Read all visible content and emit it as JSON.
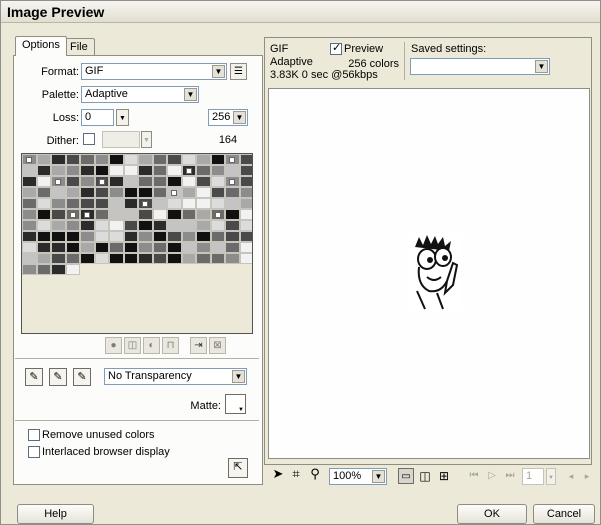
{
  "window": {
    "title": "Image Preview"
  },
  "tabs": [
    {
      "label": "Options",
      "active": true
    },
    {
      "label": "File",
      "active": false
    }
  ],
  "options": {
    "format_label": "Format:",
    "format_value": "GIF",
    "palette_label": "Palette:",
    "palette_value": "Adaptive",
    "loss_label": "Loss:",
    "loss_value": "0",
    "colors_value": "256",
    "dither_label": "Dither:",
    "dither_checked": false,
    "color_count": "164",
    "transparency_value": "No Transparency",
    "matte_label": "Matte:",
    "remove_unused_label": "Remove unused colors",
    "remove_unused_checked": false,
    "interlaced_label": "Interlaced browser display",
    "interlaced_checked": false
  },
  "preview_info": {
    "format": "GIF",
    "palette": "Adaptive",
    "size_time": "3.83K  0 sec @56kbps",
    "preview_label": "Preview",
    "preview_checked": true,
    "colors": "256 colors",
    "saved_settings_label": "Saved settings:",
    "saved_settings_value": ""
  },
  "toolbar": {
    "zoom_value": "100%",
    "frame_value": "1"
  },
  "buttons": {
    "help": "Help",
    "ok": "OK",
    "cancel": "Cancel"
  },
  "colors": {
    "window_bg": "#ece9d8",
    "palette_dark": "#111111",
    "palette_mid": "#808080",
    "palette_light": "#d6d6d6"
  }
}
